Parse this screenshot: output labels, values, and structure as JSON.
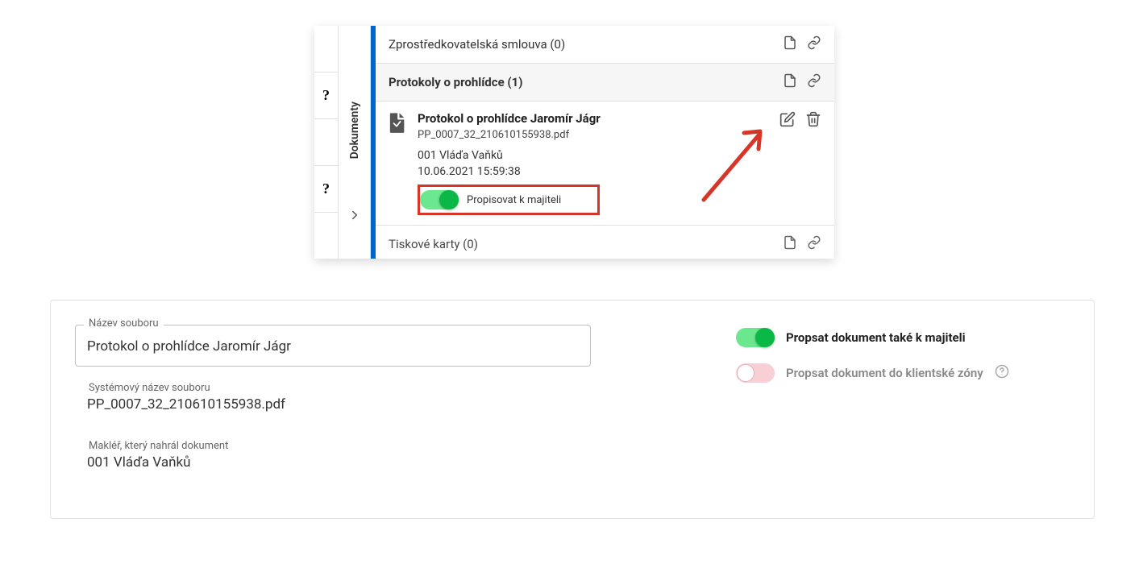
{
  "panel": {
    "tab_label": "Dokumenty",
    "rows": [
      {
        "title": "Zprostředkovatelská smlouva (0)"
      },
      {
        "title": "Protokoly o prohlídce (1)"
      },
      {
        "title": "Tiskové karty (0)"
      }
    ]
  },
  "doc_item": {
    "name": "Protokol o prohlídce Jaromír Jágr",
    "filename": "PP_0007_32_210610155938.pdf",
    "broker": "001 Vláďa Vaňků",
    "timestamp": "10.06.2021 15:59:38",
    "toggle_label": "Propisovat k majiteli"
  },
  "form": {
    "fields": {
      "name_label": "Název souboru",
      "name_value": "Protokol o prohlídce Jaromír Jágr",
      "sysname_label": "Systémový název souboru",
      "sysname_value": "PP_0007_32_210610155938.pdf",
      "broker_label": "Makléř, který nahrál dokument",
      "broker_value": "001 Vláďa Vaňků"
    },
    "toggles": {
      "owner_label": "Propsat dokument také k majiteli",
      "client_zone_label": "Propsat dokument do klientské zóny"
    }
  }
}
